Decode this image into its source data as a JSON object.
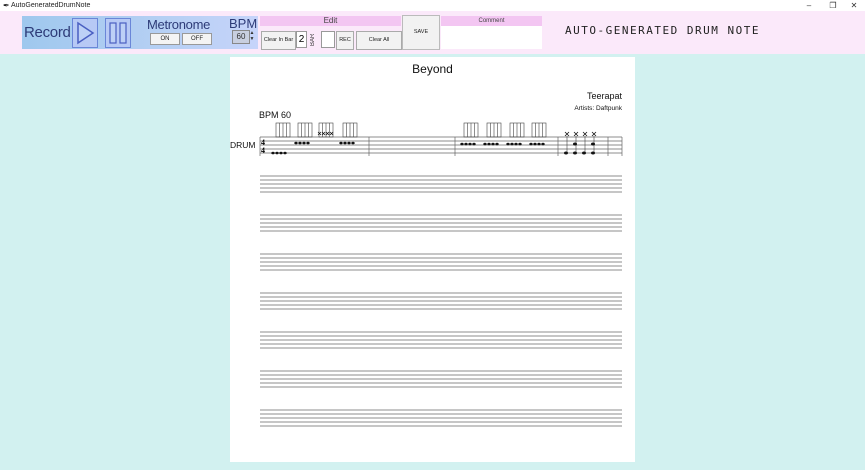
{
  "window": {
    "title": "AutoGeneratedDrumNote",
    "minimize": "–",
    "maximize": "❐",
    "close": "✕"
  },
  "toolbar": {
    "record_label": "Record",
    "metronome_label": "Metronome",
    "metronome_on": "ON",
    "metronome_off": "OFF",
    "bpm_label": "BPM",
    "bpm_value": "60",
    "edit_label": "Edit",
    "clear_in_bar": "Clear In Bar",
    "bar_number": "2",
    "bar_label": "BAR",
    "rec_label": "REC",
    "clear_all": "Clear All",
    "save_label": "SAVE",
    "comment_label": "Comment",
    "comment_value": ""
  },
  "app_title": "AUTO-GENERATED DRUM NOTE",
  "sheet": {
    "song_title": "Beyond",
    "composer": "Teerapat",
    "artists": "Artists: Daftpunk",
    "bpm_marking": "BPM 60",
    "instrument": "DRUM",
    "time_signature_top": "4",
    "time_signature_bottom": "4",
    "empty_staff_rows": 7
  },
  "colors": {
    "background": "#d2f1f0",
    "toolbar": "#fbe9fa",
    "header_pink": "#f3c6f2",
    "blue_panel": "#b4cff3",
    "accent_text": "#2d3b78"
  }
}
